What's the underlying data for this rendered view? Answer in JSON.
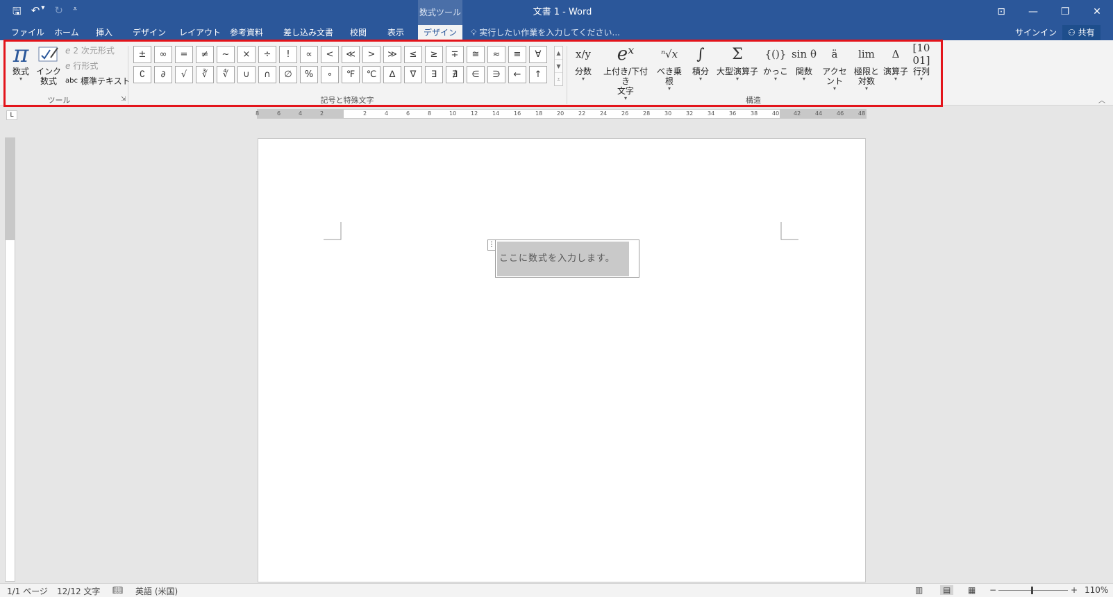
{
  "title": "文書 1 - Word",
  "context_tab_group": "数式ツール",
  "qat": {
    "save": "🖫",
    "undo": "↶",
    "undo_dd": "▾",
    "redo": "↻",
    "customize": "⩡"
  },
  "window": {
    "ribbon_display": "⊡",
    "minimize": "—",
    "restore": "❐",
    "close": "✕"
  },
  "tabs": [
    "ファイル",
    "ホーム",
    "挿入",
    "デザイン",
    "レイアウト",
    "参考資料",
    "差し込み文書",
    "校閲",
    "表示",
    "デザイン"
  ],
  "tell_me": "実行したい作業を入力してください...",
  "signin": "サインイン",
  "share": "共有",
  "tools": {
    "equation": "数式",
    "ink_equation": "インク\n数式",
    "professional": "2 次元形式",
    "linear": "行形式",
    "normal_text": "標準テキスト",
    "abc": "abc",
    "group_label": "ツール"
  },
  "symbols": {
    "row1": [
      "±",
      "∞",
      "=",
      "≠",
      "~",
      "×",
      "÷",
      "!",
      "∝",
      "<",
      "≪",
      ">",
      "≫",
      "≤",
      "≥",
      "∓",
      "≅",
      "≈",
      "≡",
      "∀"
    ],
    "row2": [
      "∁",
      "∂",
      "√",
      "∛",
      "∜",
      "∪",
      "∩",
      "∅",
      "%",
      "∘",
      "℉",
      "℃",
      "∆",
      "∇",
      "∃",
      "∄",
      "∈",
      "∋",
      "←",
      "↑"
    ],
    "group_label": "記号と特殊文字"
  },
  "structures": {
    "items": [
      {
        "icon": "x/y",
        "label": "分数"
      },
      {
        "icon": "eˣ",
        "label": "上付き/下付き\n文字"
      },
      {
        "icon": "ⁿ√x",
        "label": "べき乗根"
      },
      {
        "icon": "∫",
        "label": "積分"
      },
      {
        "icon": "Σ",
        "label": "大型演算子"
      },
      {
        "icon": "{()}",
        "label": "かっこ"
      },
      {
        "icon": "sin θ",
        "label": "関数"
      },
      {
        "icon": "ä",
        "label": "アクセント"
      },
      {
        "icon": "lim",
        "label": "極限と\n対数"
      },
      {
        "icon": "Δ",
        "label": "演算子"
      },
      {
        "icon": "[10 01]",
        "label": "行列"
      }
    ],
    "group_label": "構造"
  },
  "ruler_h": [
    "8",
    "6",
    "4",
    "2",
    "",
    "2",
    "4",
    "6",
    "8",
    "10",
    "12",
    "14",
    "16",
    "18",
    "20",
    "22",
    "24",
    "26",
    "28",
    "30",
    "32",
    "34",
    "36",
    "38",
    "40",
    "42",
    "44",
    "46",
    "48"
  ],
  "ruler_corner": "L",
  "equation_placeholder": "ここに数式を入力します。",
  "status": {
    "page": "1/1 ページ",
    "words": "12/12 文字",
    "language": "英語 (米国)",
    "zoom": "110%"
  }
}
